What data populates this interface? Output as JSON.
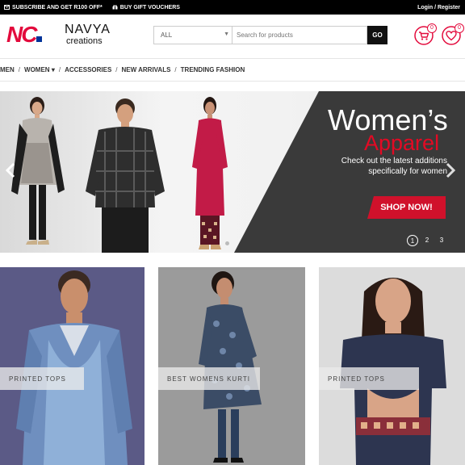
{
  "topbar": {
    "promo_subscribe": "SUBSCRIBE AND GET R100 OFF*",
    "promo_vouchers": "BUY GIFT VOUCHERS",
    "auth": "Login / Register"
  },
  "header": {
    "logo_mark": "NC",
    "logo_name": "NAVYA",
    "logo_sub": "creations",
    "search": {
      "category": "ALL",
      "placeholder": "Search for products",
      "button": "GO"
    },
    "cart_count": "0",
    "wishlist_count": "0",
    "icons": [
      "cart-icon",
      "heart-icon"
    ]
  },
  "nav": {
    "items": [
      "MEN",
      "WOMEN",
      "ACCESSORIES",
      "NEW ARRIVALS",
      "TRENDING FASHION"
    ],
    "women_caret": "▾"
  },
  "banner": {
    "headline_1": "Women’s",
    "headline_2": "Apparel",
    "copy_line_1": "Check out the latest additions",
    "copy_line_2": "specifically for women",
    "cta": "SHOP NOW!",
    "pages": [
      "1",
      "2",
      "3"
    ],
    "active_page": "1"
  },
  "tiles": [
    {
      "label": "PRINTED TOPS"
    },
    {
      "label": "BEST WOMENS KURTI"
    },
    {
      "label": "PRINTED TOPS"
    }
  ],
  "colors": {
    "brand_red": "#e30a3c",
    "brand_blue": "#003399",
    "banner_dark": "#3a3a3a",
    "cta_red": "#d0112b"
  }
}
